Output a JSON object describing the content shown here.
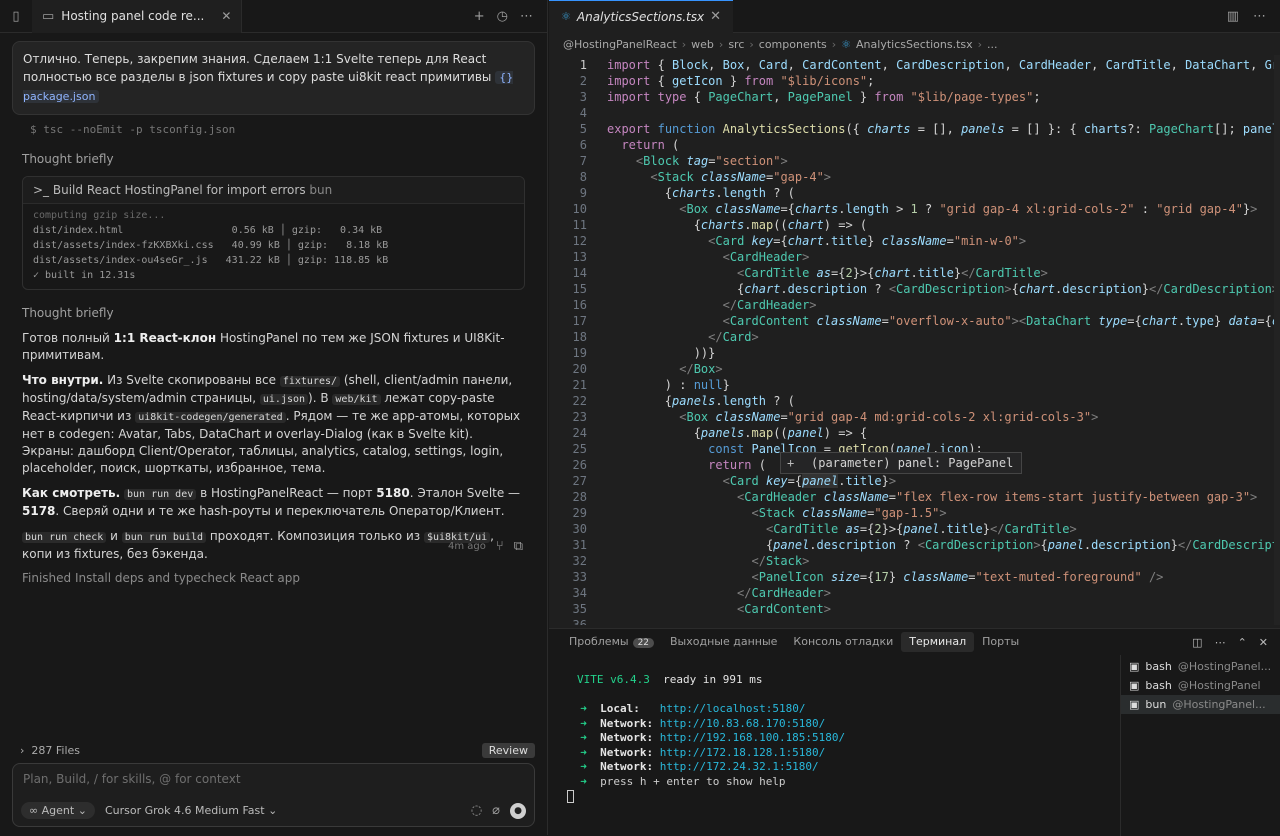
{
  "chat": {
    "tab_title": "Hosting panel code re...",
    "user_message": "Отлично. Теперь, закрепим знания. Сделаем 1:1 Svelte теперь для React полностью все разделы в json fixtures и copy paste ui8kit react примитивы",
    "user_chip": "{} package.json",
    "command_tail": "$ tsc --noEmit -p tsconfig.json",
    "thought1": "Thought briefly",
    "build_title": "Build React HostingPanel for import errors",
    "build_tag": "bun",
    "build_lines": [
      "computing gzip size...",
      "dist/index.html                  0.56 kB │ gzip:   0.34 kB",
      "dist/assets/index-fzKXBXki.css   40.99 kB │ gzip:   8.18 kB",
      "dist/assets/index-ou4seGr_.js   431.22 kB │ gzip: 118.85 kB",
      "✓ built in 12.31s"
    ],
    "thought2": "Thought briefly",
    "p1_pre": "Готов полный ",
    "p1_bold": "1:1 React-клон",
    "p1_post": " HostingPanel по тем же JSON fixtures и UI8Kit-примитивам.",
    "p2_bold": "Что внутри.",
    "p2_a": " Из Svelte скопированы все ",
    "p2_code1": "fixtures/",
    "p2_b": " (shell, client/admin панели, hosting/data/system/admin страницы, ",
    "p2_code2": "ui.json",
    "p2_c": "). В ",
    "p2_code3": "web/kit",
    "p2_d": " лежат copy-paste React-кирпичи из ",
    "p2_code4": "ui8kit-codegen/generated",
    "p2_e": ". Рядом — те же app-атомы, которых нет в codegen: Avatar, Tabs, DataChart и overlay-Dialog (как в Svelte kit). Экраны: дашборд Client/Operator, таблицы, analytics, catalog, settings, login, placeholder, поиск, шорткаты, избранное, тема.",
    "p3_bold": "Как смотреть.",
    "p3_code": "bun run dev",
    "p3_a": " в HostingPanelReact — порт ",
    "p3_b1": "5180",
    "p3_b": ". Эталон Svelte — ",
    "p3_b2": "5178",
    "p3_c": ". Сверяй одни и те же hash-роуты и переключатель Оператор/Клиент.",
    "p4_code1": "bun run check",
    "p4_a": " и ",
    "p4_code2": "bun run build",
    "p4_b": " проходят. Композиция только из ",
    "p4_code3": "$ui8kit/ui",
    "p4_c": ", копи из fixtures, без бэкенда.",
    "finished": "Finished Install deps and typecheck React app",
    "time_ago": "4m ago",
    "files_count": "287 Files",
    "review_label": "Review",
    "composer_placeholder": "Plan, Build, / for skills, @ for context",
    "agent_label": "∞ Agent ⌄",
    "model_label": "Cursor Grok 4.6 Medium Fast ⌄"
  },
  "editor": {
    "tab_title": "AnalyticsSections.tsx",
    "crumbs": [
      "@HostingPanelReact",
      "web",
      "src",
      "components",
      "AnalyticsSections.tsx",
      "..."
    ],
    "tooltip": "(parameter) panel: PagePanel"
  },
  "panel": {
    "tabs": [
      "Проблемы",
      "Выходные данные",
      "Консоль отладки",
      "Терминал",
      "Порты"
    ],
    "problems_count": "22",
    "terminals": [
      {
        "name": "bash",
        "sub": "@HostingPanel..."
      },
      {
        "name": "bash",
        "sub": "@HostingPanel"
      },
      {
        "name": "bun",
        "sub": "@HostingPanel..."
      }
    ],
    "vite_name": "VITE v6.4.3",
    "vite_ready": "ready in 991 ms",
    "urls": [
      [
        "Local:",
        "http://localhost:5180/"
      ],
      [
        "Network:",
        "http://10.83.68.170:5180/"
      ],
      [
        "Network:",
        "http://192.168.100.185:5180/"
      ],
      [
        "Network:",
        "http://172.18.128.1:5180/"
      ],
      [
        "Network:",
        "http://172.24.32.1:5180/"
      ]
    ],
    "help": "press h + enter to show help"
  },
  "colors": {
    "accent": "#3794ff",
    "terminal_green": "#23d18b",
    "terminal_cyan": "#29b8db"
  }
}
